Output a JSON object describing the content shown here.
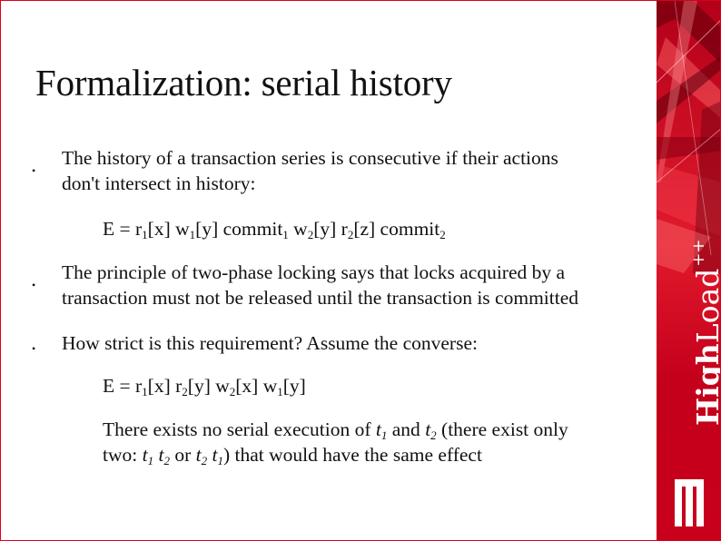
{
  "slide": {
    "title": "Formalization: serial history",
    "bullet_glyph": "•",
    "b1": {
      "line1": "The history of a transaction series is consecutive if their actions",
      "line2": "don't intersect in history:"
    },
    "f1": {
      "p0": "E = r",
      "s1": "1",
      "p1": "[x] w",
      "s2": "1",
      "p2": "[y] commit",
      "s3": "1",
      "p3": " w",
      "s4": "2",
      "p4": "[y] r",
      "s5": "2",
      "p5": "[z] commit",
      "s6": "2"
    },
    "b2": {
      "line1": "The principle of two-phase locking says that locks acquired by a",
      "line2": "transaction must not be released until the transaction is committed"
    },
    "b3": {
      "line1": "How strict is this requirement? Assume the converse:"
    },
    "f2": {
      "p0": "E = r",
      "s1": "1",
      "p1": "[x] r",
      "s2": "2",
      "p2": "[y] w",
      "s3": "2",
      "p3": "[x] w",
      "s4": "1",
      "p4": "[y]"
    },
    "note": {
      "l1a": "There exists no serial execution of ",
      "t1": "t",
      "t1s": "1",
      "l1b": " and ",
      "t2": "t",
      "t2s": "2",
      "l1c": " (there exist only",
      "l2a": "two: ",
      "t3": "t",
      "t3s": "1",
      "sp": " ",
      "t4": "t",
      "t4s": "2",
      "l2b": " or ",
      "t5": "t",
      "t5s": "2",
      "sp2": " ",
      "t6": "t",
      "t6s": "1",
      "l2c": ") that would have the same effect"
    }
  },
  "brand": {
    "logo_bold": "High",
    "logo_light": "Load",
    "logo_sup": "++",
    "colors": {
      "accent": "#c8001b",
      "dark": "#7a0010",
      "light": "#ff6b6b",
      "white": "#ffffff"
    }
  }
}
